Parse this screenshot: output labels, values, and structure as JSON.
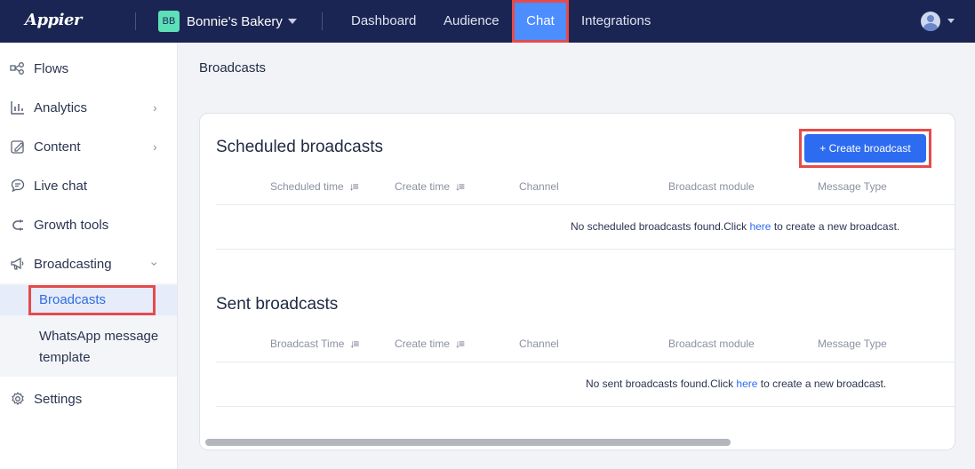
{
  "app": {
    "logo": "Appier"
  },
  "brand": {
    "badge": "BB",
    "name": "Bonnie's Bakery"
  },
  "nav": {
    "dashboard": "Dashboard",
    "audience": "Audience",
    "chat": "Chat",
    "integrations": "Integrations"
  },
  "sidebar": {
    "flows": "Flows",
    "analytics": "Analytics",
    "content": "Content",
    "live_chat": "Live chat",
    "growth_tools": "Growth tools",
    "broadcasting": "Broadcasting",
    "broadcasts": "Broadcasts",
    "whatsapp_line1": "WhatsApp message",
    "whatsapp_line2": "template",
    "settings": "Settings"
  },
  "breadcrumb": "Broadcasts",
  "scheduled": {
    "title": "Scheduled broadcasts",
    "create_button": "+ Create broadcast",
    "columns": [
      "Scheduled time",
      "Create time",
      "Channel",
      "Broadcast module",
      "Message Type"
    ],
    "empty_before": "No scheduled broadcasts found.Click ",
    "empty_link": "here",
    "empty_after": " to create a new broadcast."
  },
  "sent": {
    "title": "Sent broadcasts",
    "columns": [
      "Broadcast Time",
      "Create time",
      "Channel",
      "Broadcast module",
      "Message Type"
    ],
    "empty_before": "No sent broadcasts found.Click ",
    "empty_link": "here",
    "empty_after": " to create a new broadcast."
  }
}
